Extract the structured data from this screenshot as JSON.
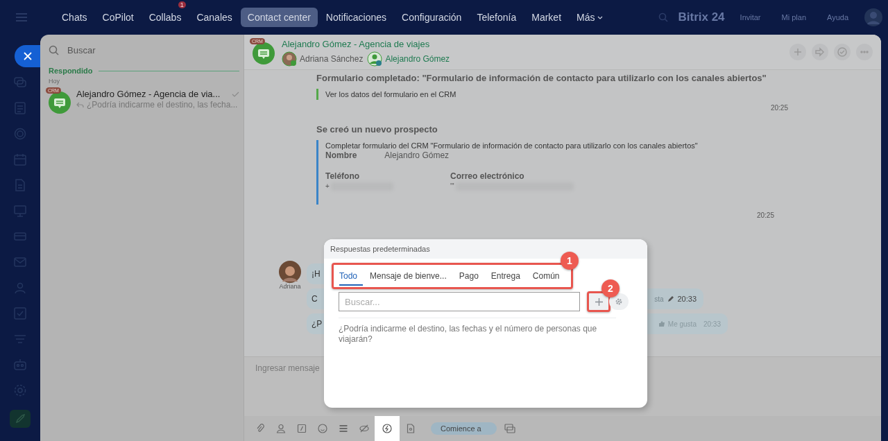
{
  "top_nav": {
    "items": [
      {
        "label": "Chats",
        "selected": false
      },
      {
        "label": "CoPilot",
        "selected": false
      },
      {
        "label": "Collabs",
        "selected": false,
        "badge": "1"
      },
      {
        "label": "Canales",
        "selected": false
      },
      {
        "label": "Contact center",
        "selected": true
      },
      {
        "label": "Notificaciones",
        "selected": false
      },
      {
        "label": "Configuración",
        "selected": false
      },
      {
        "label": "Telefonía",
        "selected": false
      },
      {
        "label": "Market",
        "selected": false
      },
      {
        "label": "Más",
        "selected": false,
        "kind": "dropdown"
      }
    ],
    "logo": "Bitrix 24",
    "links": [
      "Invitar",
      "Mi plan",
      "Ayuda"
    ]
  },
  "chat_list": {
    "search_placeholder": "Buscar",
    "section": "Respondido",
    "date": "Hoy",
    "items": [
      {
        "badge": "CRM",
        "title": "Alejandro Gómez - Agencia de via...",
        "preview": "¿Podría indicarme el destino, las fecha...",
        "read": true
      }
    ]
  },
  "chat_header": {
    "badge": "CRM",
    "title": "Alejandro Gómez - Agencia de viajes",
    "members": [
      {
        "name": "Adriana Sánchez",
        "kind": "operator"
      },
      {
        "name": "Alejandro Gómez",
        "kind": "client"
      }
    ]
  },
  "messages": [
    {
      "kind": "form",
      "title": "Formulario completado: \"Formulario de información de contacto para utilizarlo con los canales abiertos\"",
      "link": "Ver los datos del formulario en el CRM",
      "time": "20:25"
    },
    {
      "kind": "lead",
      "title": "Se creó un nuevo prospecto",
      "note": "Completar formulario del CRM \"Formulario de información de contacto para utilizarlo con los canales abiertos\"",
      "name_label": "Nombre",
      "name_value": "Alejandro Gómez",
      "columns": [
        {
          "label": "Teléfono",
          "value": "+"
        },
        {
          "label": "Correo electrónico",
          "value": "'''"
        }
      ],
      "time": "20:25"
    }
  ],
  "incoming": {
    "author": "Adriana",
    "bubbles": [
      {
        "text": "¡H"
      },
      {
        "text": "C",
        "kind": "edited",
        "reaction": "sta",
        "time": "20:33"
      },
      {
        "text": "¿P",
        "kind": "liked",
        "reaction": "Me gusta",
        "time": "20:33"
      }
    ]
  },
  "composer": {
    "placeholder": "Ingresar mensaje",
    "pill": "Comience a",
    "tools": [
      {
        "kind": "attach",
        "selected": false
      },
      {
        "kind": "person",
        "selected": false
      },
      {
        "kind": "slash",
        "selected": false
      },
      {
        "kind": "smile",
        "selected": false
      },
      {
        "kind": "stack",
        "selected": false
      },
      {
        "kind": "hidden",
        "selected": false
      },
      {
        "kind": "bolt",
        "selected": true
      },
      {
        "kind": "doc",
        "selected": false
      }
    ]
  },
  "quick_answers": {
    "title": "Respuestas predeterminadas",
    "tabs": [
      {
        "label": "Todo",
        "selected": true
      },
      {
        "label": "Mensaje de bienve...",
        "selected": false
      },
      {
        "label": "Pago",
        "selected": false
      },
      {
        "label": "Entrega",
        "selected": false
      },
      {
        "label": "Común",
        "selected": false
      }
    ],
    "search_placeholder": "Buscar...",
    "answers": [
      "¿Podría indicarme el destino, las fechas y el número de personas que viajarán?"
    ]
  },
  "callouts": [
    "1",
    "2"
  ]
}
